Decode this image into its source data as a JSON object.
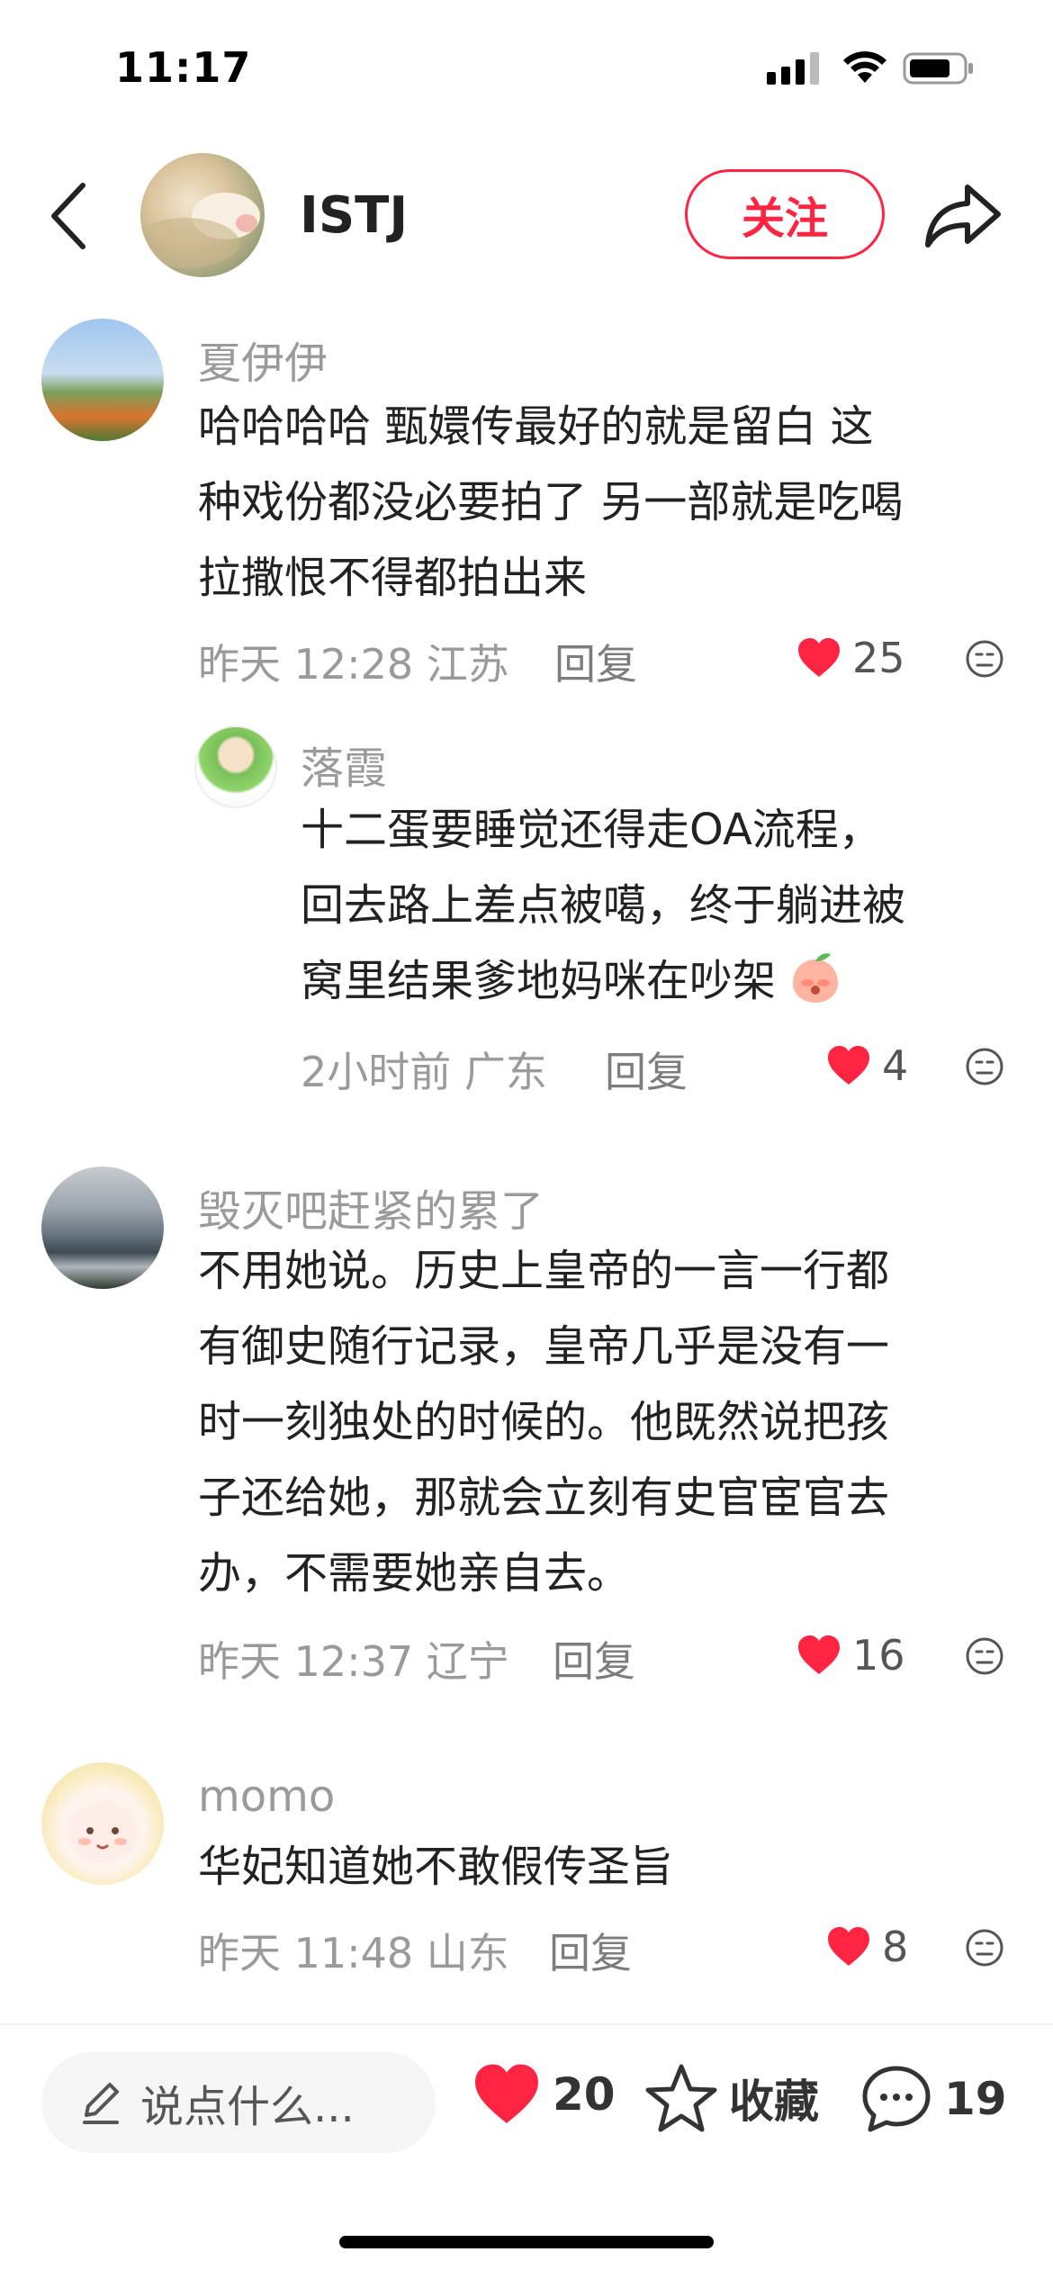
{
  "status_bar": {
    "time": "11:17"
  },
  "header": {
    "author_name": "ISTJ",
    "follow_label": "关注"
  },
  "comments": [
    {
      "name": "夏伊伊",
      "text_lines": [
        "哈哈哈哈 甄嬛传最好的就是留白 这",
        "种戏份都没必要拍了 另一部就是吃喝",
        "拉撒恨不得都拍出来"
      ],
      "meta": "昨天 12:28 江苏",
      "reply_label": "回复",
      "likes": "25",
      "replies": [
        {
          "name": "落霞",
          "text_lines": [
            "十二蛋要睡觉还得走OA流程，",
            "回去路上差点被噶，终于躺进被",
            "窝里结果爹地妈咪在吵架"
          ],
          "meta": "2小时前 广东",
          "reply_label": "回复",
          "likes": "4"
        }
      ]
    },
    {
      "name": "毁灭吧赶紧的累了",
      "text_lines": [
        "不用她说。历史上皇帝的一言一行都",
        "有御史随行记录，皇帝几乎是没有一",
        "时一刻独处的时候的。他既然说把孩",
        "子还给她，那就会立刻有史官宦官去",
        "办，不需要她亲自去。"
      ],
      "meta": "昨天 12:37 辽宁",
      "reply_label": "回复",
      "likes": "16"
    },
    {
      "name": "momo",
      "text_lines": [
        "华妃知道她不敢假传圣旨"
      ],
      "meta": "昨天 11:48 山东",
      "reply_label": "回复",
      "likes": "8"
    }
  ],
  "bottom_bar": {
    "input_placeholder": "说点什么...",
    "likes": "20",
    "collect_label": "收藏",
    "comments_count": "19"
  },
  "colors": {
    "accent": "#ff2442",
    "meta_gray": "#9a9a9a"
  },
  "icons": [
    "back-icon",
    "share-icon",
    "heart-icon",
    "dislike-icon",
    "pencil-icon",
    "star-icon",
    "chat-bubble-icon"
  ]
}
